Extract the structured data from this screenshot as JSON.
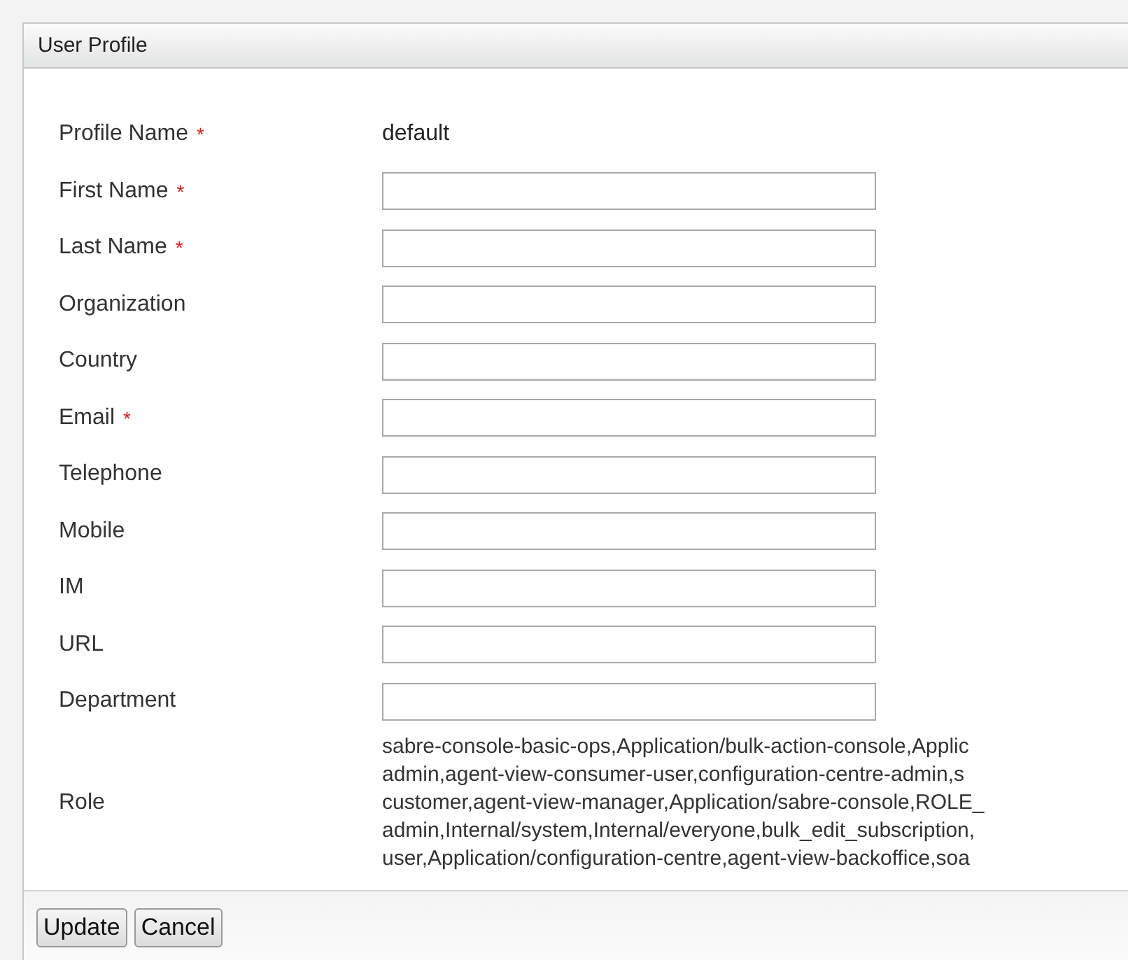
{
  "panel": {
    "title": "User Profile"
  },
  "profile_name": {
    "label": "Profile Name",
    "required": true,
    "value": "default"
  },
  "fields": [
    {
      "label": "First Name",
      "required": true
    },
    {
      "label": "Last Name",
      "required": true
    },
    {
      "label": "Organization",
      "required": false
    },
    {
      "label": "Country",
      "required": false
    },
    {
      "label": "Email",
      "required": true
    },
    {
      "label": "Telephone",
      "required": false
    },
    {
      "label": "Mobile",
      "required": false
    },
    {
      "label": "IM",
      "required": false
    },
    {
      "label": "URL",
      "required": false
    },
    {
      "label": "Department",
      "required": false
    }
  ],
  "role": {
    "label": "Role",
    "lines": [
      "sabre-console-basic-ops,Application/bulk-action-console,Applic",
      "admin,agent-view-consumer-user,configuration-centre-admin,s",
      "customer,agent-view-manager,Application/sabre-console,ROLE_",
      "admin,Internal/system,Internal/everyone,bulk_edit_subscription,",
      "user,Application/configuration-centre,agent-view-backoffice,soa"
    ]
  },
  "required_mark": "*",
  "buttons": [
    "Update",
    "Cancel"
  ]
}
